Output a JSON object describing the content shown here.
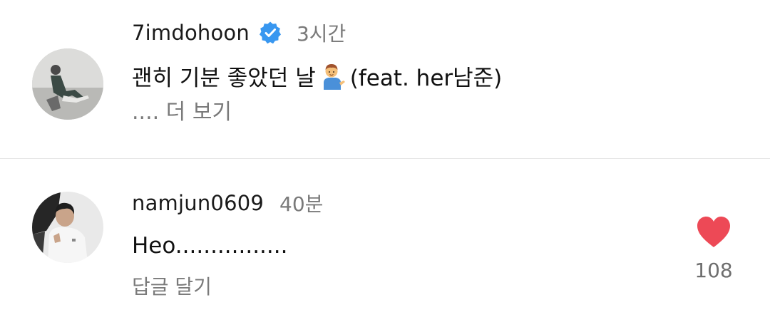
{
  "post": {
    "username": "7imdohoon",
    "verified_icon": "verified-badge-icon",
    "time": "3시간",
    "caption_prefix": "괜히 기분 좋았던 날",
    "caption_emoji": "person-tipping-hand-emoji",
    "caption_suffix": "(feat. her남준)",
    "more_label": ".... 더 보기"
  },
  "comment": {
    "username": "namjun0609",
    "time": "40분",
    "text": "Heo................",
    "reply_label": "답글 달기",
    "like_icon": "heart-icon",
    "like_count": "108"
  },
  "colors": {
    "verified_blue": "#3897f0",
    "like_red": "#ed4956",
    "secondary_text": "#7a7a7a"
  }
}
